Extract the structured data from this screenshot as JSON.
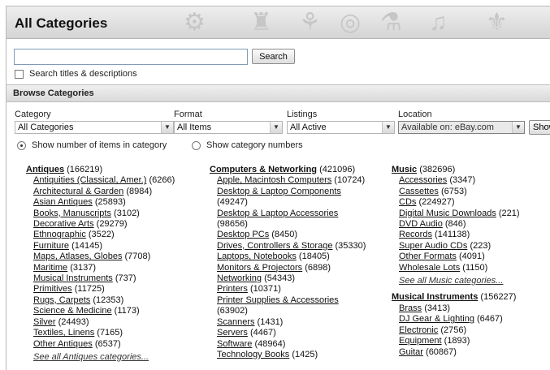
{
  "page": {
    "title": "All Categories"
  },
  "search": {
    "input_value": "",
    "button_label": "Search",
    "titles_desc_label": "Search titles & descriptions",
    "titles_desc_checked": false
  },
  "browse": {
    "header": "Browse Categories",
    "filters": {
      "category": {
        "label": "Category",
        "value": "All Categories"
      },
      "format": {
        "label": "Format",
        "value": "All Items"
      },
      "listings": {
        "label": "Listings",
        "value": "All Active"
      },
      "location": {
        "label": "Location",
        "value": "Available on: eBay.com"
      },
      "show_button_label": "Show"
    },
    "display_options": [
      {
        "label": "Show number of items in category",
        "selected": true
      },
      {
        "label": "Show category numbers",
        "selected": false
      }
    ]
  },
  "columns": [
    {
      "sections": [
        {
          "name": "Antiques",
          "count": "(166219)",
          "items": [
            {
              "name": "Antiquities (Classical, Amer.)",
              "count": "(6266)"
            },
            {
              "name": "Architectural & Garden",
              "count": "(8984)"
            },
            {
              "name": "Asian Antiques",
              "count": "(25893)"
            },
            {
              "name": "Books, Manuscripts",
              "count": "(3102)"
            },
            {
              "name": "Decorative Arts",
              "count": "(29279)"
            },
            {
              "name": "Ethnographic",
              "count": "(3522)"
            },
            {
              "name": "Furniture",
              "count": "(14145)"
            },
            {
              "name": "Maps, Atlases, Globes",
              "count": "(7708)"
            },
            {
              "name": "Maritime",
              "count": "(3137)"
            },
            {
              "name": "Musical Instruments",
              "count": "(737)"
            },
            {
              "name": "Primitives",
              "count": "(11725)"
            },
            {
              "name": "Rugs, Carpets",
              "count": "(12353)"
            },
            {
              "name": "Science & Medicine",
              "count": "(1173)"
            },
            {
              "name": "Silver",
              "count": "(24493)"
            },
            {
              "name": "Textiles, Linens",
              "count": "(7165)"
            },
            {
              "name": "Other Antiques",
              "count": "(6537)"
            }
          ],
          "see_all": "See all Antiques categories..."
        }
      ]
    },
    {
      "sections": [
        {
          "name": "Computers & Networking",
          "count": "(421096)",
          "items": [
            {
              "name": "Apple, Macintosh Computers",
              "count": "(10724)"
            },
            {
              "name": "Desktop & Laptop Components",
              "count": "(49247)",
              "wrap": true
            },
            {
              "name": "Desktop & Laptop Accessories",
              "count": "(98656)",
              "wrap": true
            },
            {
              "name": "Desktop PCs",
              "count": "(8450)"
            },
            {
              "name": "Drives, Controllers & Storage",
              "count": "(35330)"
            },
            {
              "name": "Laptops, Notebooks",
              "count": "(18405)"
            },
            {
              "name": "Monitors & Projectors",
              "count": "(6898)"
            },
            {
              "name": "Networking",
              "count": "(54343)"
            },
            {
              "name": "Printers",
              "count": "(10371)"
            },
            {
              "name": "Printer Supplies & Accessories",
              "count": "(63902)",
              "wrap": true
            },
            {
              "name": "Scanners",
              "count": "(1431)"
            },
            {
              "name": "Servers",
              "count": "(4467)"
            },
            {
              "name": "Software",
              "count": "(48964)"
            },
            {
              "name": "Technology Books",
              "count": "(1425)"
            }
          ]
        }
      ]
    },
    {
      "sections": [
        {
          "name": "Music",
          "count": "(382696)",
          "items": [
            {
              "name": "Accessories",
              "count": "(3347)"
            },
            {
              "name": "Cassettes",
              "count": "(6753)"
            },
            {
              "name": "CDs",
              "count": "(224927)"
            },
            {
              "name": "Digital Music Downloads",
              "count": "(221)"
            },
            {
              "name": "DVD Audio",
              "count": "(846)"
            },
            {
              "name": "Records",
              "count": "(141138)"
            },
            {
              "name": "Super Audio CDs",
              "count": "(223)"
            },
            {
              "name": "Other Formats",
              "count": "(4091)"
            },
            {
              "name": "Wholesale Lots",
              "count": "(1150)"
            }
          ],
          "see_all": "See all Music categories..."
        },
        {
          "name": "Musical Instruments",
          "count": "(156227)",
          "items": [
            {
              "name": "Brass",
              "count": "(3413)"
            },
            {
              "name": "DJ Gear & Lighting",
              "count": "(6467)"
            },
            {
              "name": "Electronic",
              "count": "(2756)"
            },
            {
              "name": "Equipment",
              "count": "(1893)"
            },
            {
              "name": "Guitar",
              "count": "(60867)"
            }
          ]
        }
      ]
    }
  ]
}
